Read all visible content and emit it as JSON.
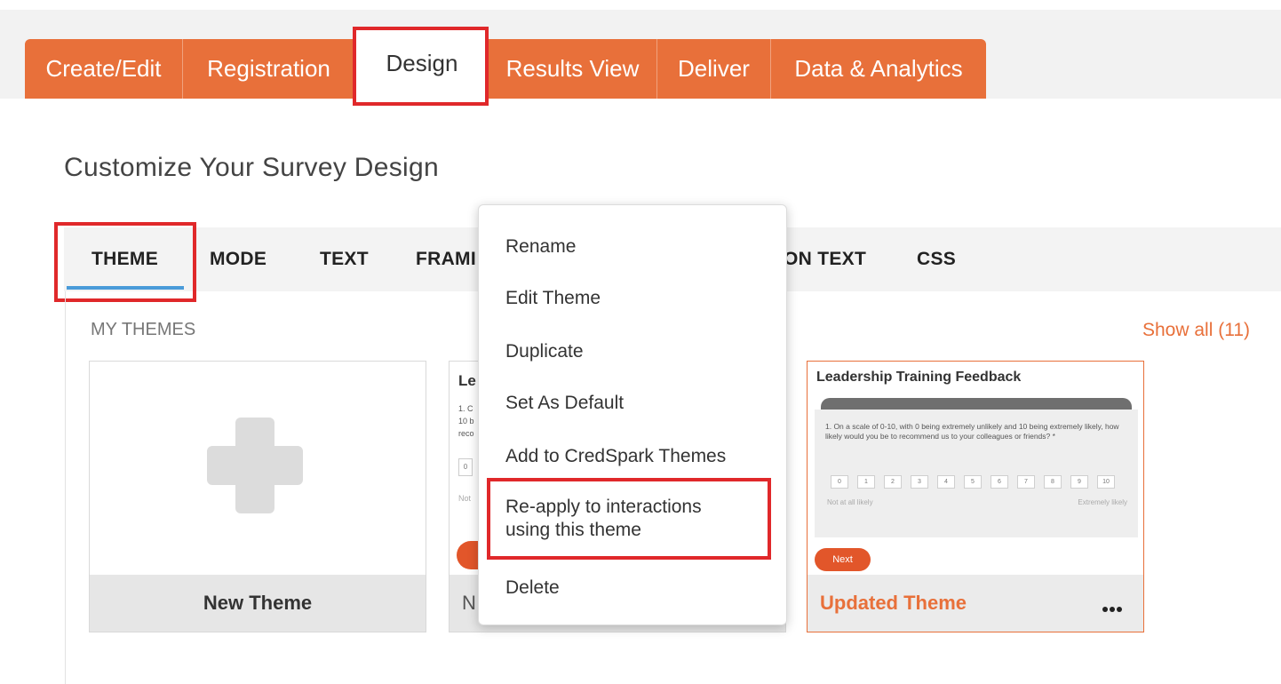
{
  "tabs": [
    {
      "label": "Create/Edit"
    },
    {
      "label": "Registration"
    },
    {
      "label": "Design"
    },
    {
      "label": "Results View"
    },
    {
      "label": "Deliver"
    },
    {
      "label": "Data & Analytics"
    }
  ],
  "page_title": "Customize Your Survey Design",
  "subtabs": {
    "theme": "THEME",
    "mode": "MODE",
    "text": "TEXT",
    "frame_partial": "FRAMI",
    "button_text_partial": "ON TEXT",
    "css": "CSS"
  },
  "section_label": "MY THEMES",
  "show_all": "Show all (11)",
  "cards": {
    "new_theme": {
      "label": "New Theme",
      "icon": "plus-icon"
    },
    "partial": {
      "title_fragment": "Le",
      "q_lines": [
        "1. C",
        "10 b",
        "reco"
      ],
      "box_digit": "0",
      "low_fragment": "Not",
      "label_fragment": "N"
    },
    "updated": {
      "preview_title": "Leadership Training Feedback",
      "question": "1.  On a scale of 0-10, with 0 being extremely unlikely and 10 being extremely likely, how likely would you be to recommend us to your colleagues or friends? *",
      "scale": [
        "0",
        "1",
        "2",
        "3",
        "4",
        "5",
        "6",
        "7",
        "8",
        "9",
        "10"
      ],
      "low_label": "Not at all likely",
      "high_label": "Extremely likely",
      "next_label": "Next",
      "label": "Updated Theme",
      "more_icon": "more-horizontal-icon"
    }
  },
  "context_menu": {
    "items": [
      {
        "label": "Rename"
      },
      {
        "label": "Edit Theme"
      },
      {
        "label": "Duplicate"
      },
      {
        "label": "Set As Default"
      },
      {
        "label": "Add to CredSpark Themes"
      },
      {
        "label": "Re-apply to interactions",
        "label2": "using this theme"
      },
      {
        "label": "Delete"
      }
    ]
  },
  "colors": {
    "accent": "#e8703a",
    "highlight": "#e0282a",
    "underline": "#4a9bd9"
  }
}
